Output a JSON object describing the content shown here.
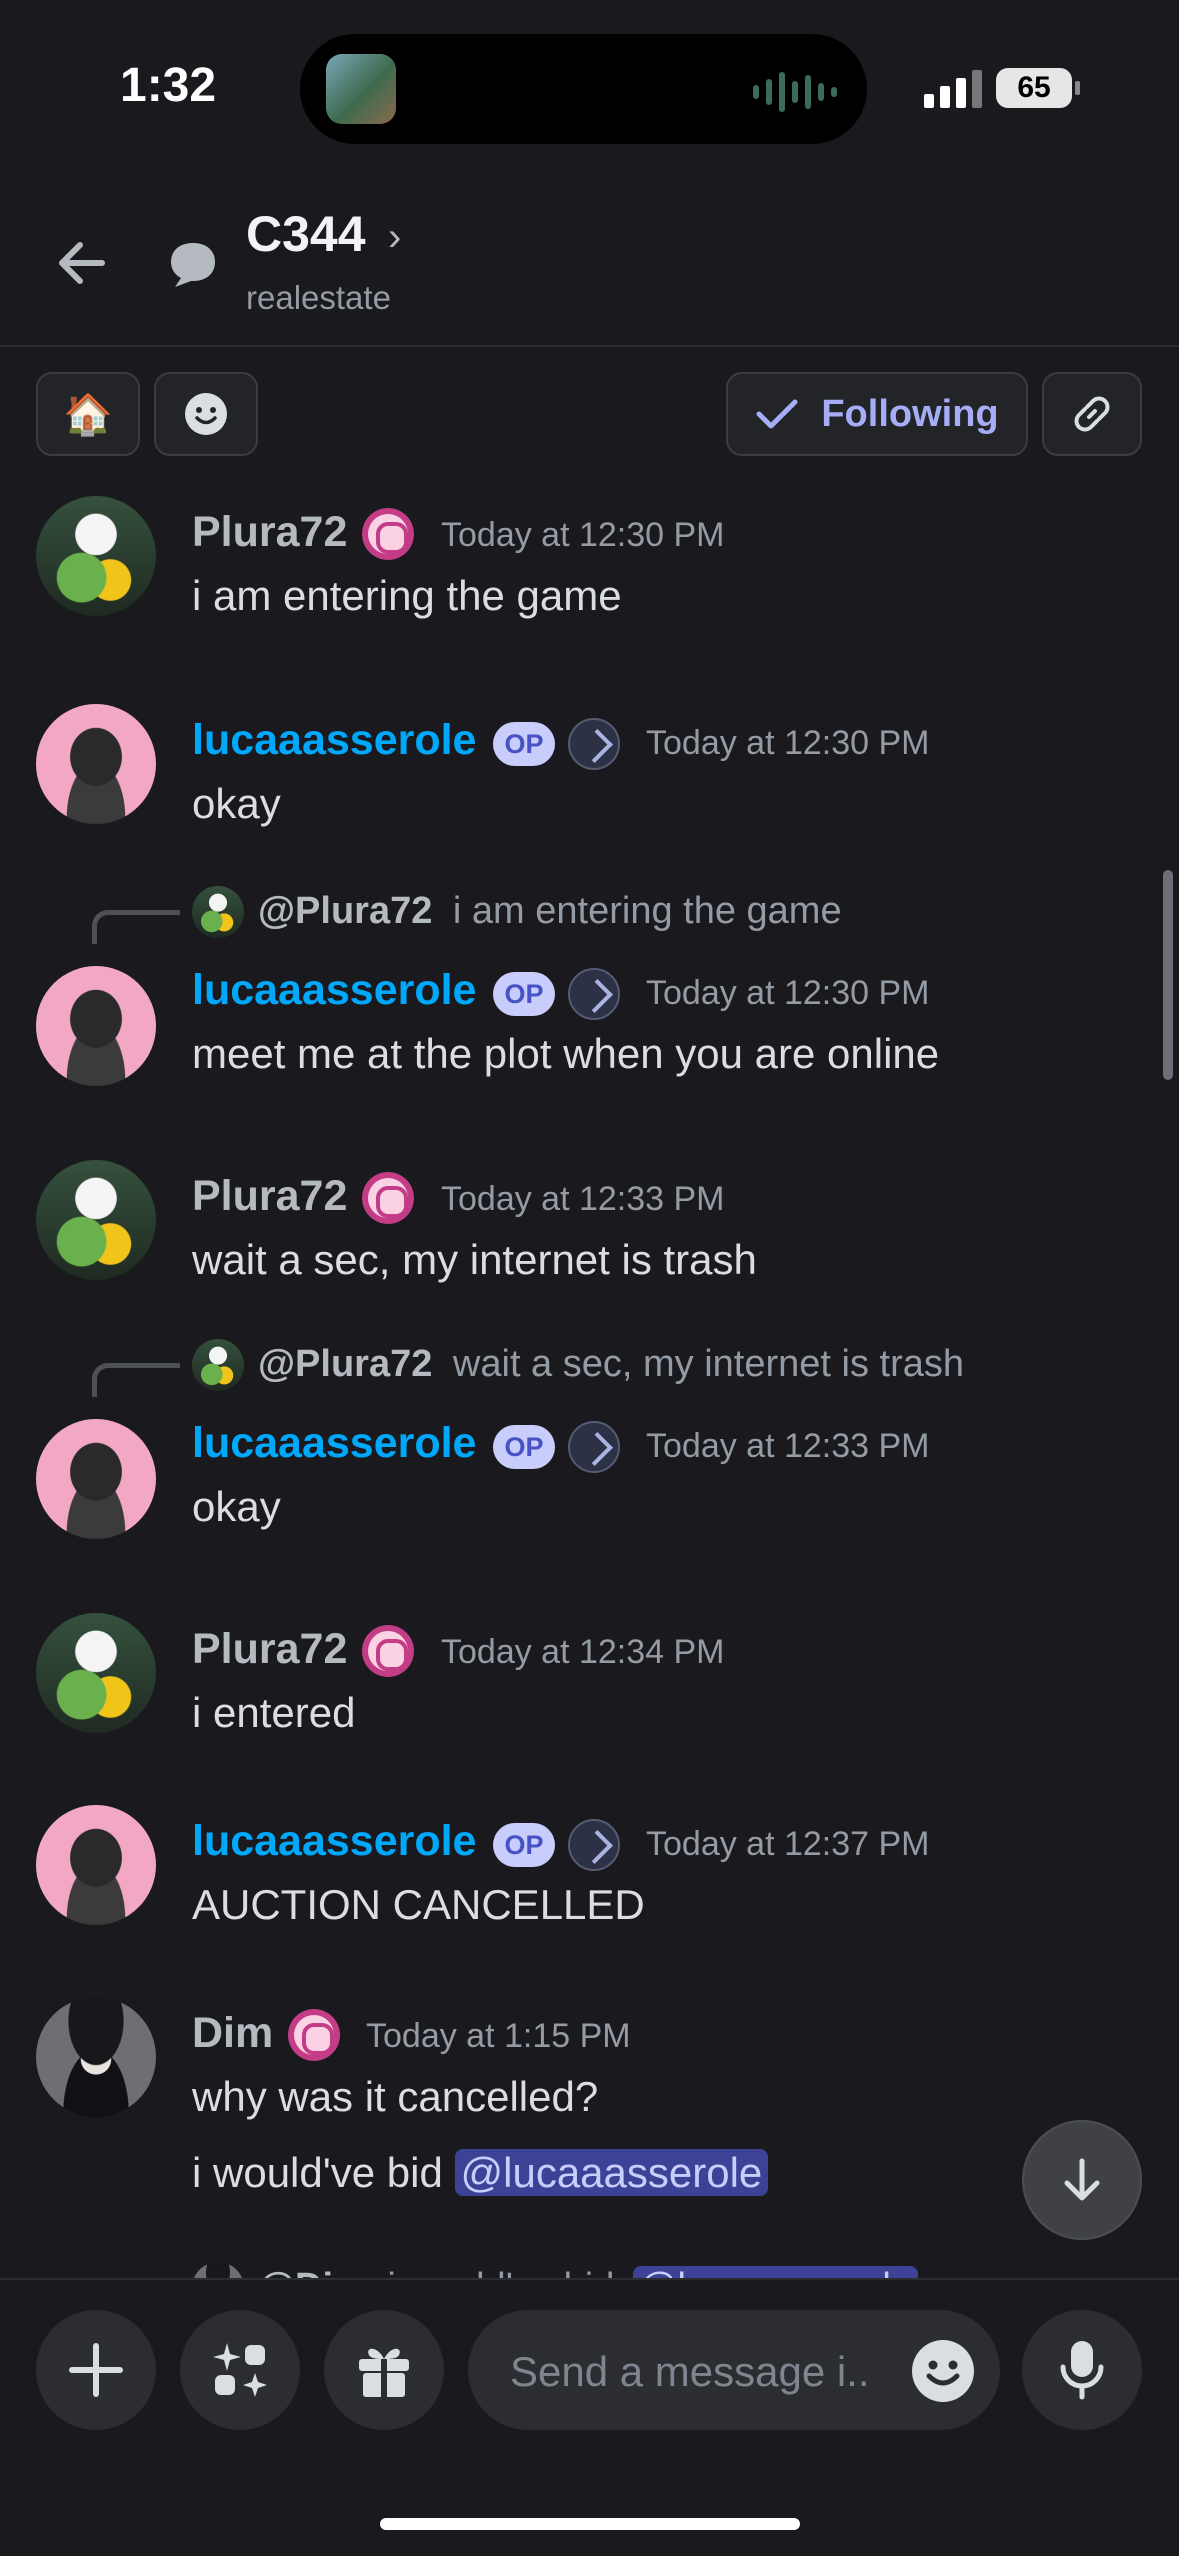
{
  "status_bar": {
    "time": "1:32",
    "battery": "65"
  },
  "header": {
    "channel_name": "C344",
    "subtitle": "realestate"
  },
  "toolbar": {
    "emoji_1": "🏠",
    "following_label": "Following"
  },
  "messages": [
    {
      "user": "Plura72",
      "time": "Today at 12:30 PM",
      "text": "i am entering the game"
    },
    {
      "user": "lucaaasserole",
      "op": "OP",
      "time": "Today at 12:30 PM",
      "text": "okay"
    },
    {
      "user": "lucaaasserole",
      "op": "OP",
      "time": "Today at 12:30 PM",
      "text": "meet me at the plot when you are online",
      "reply_user": "@Plura72",
      "reply_text": "i am entering the game"
    },
    {
      "user": "Plura72",
      "time": "Today at 12:33 PM",
      "text": "wait a sec, my internet is trash"
    },
    {
      "user": "lucaaasserole",
      "op": "OP",
      "time": "Today at 12:33 PM",
      "text": "okay",
      "reply_user": "@Plura72",
      "reply_text": "wait a sec, my internet is trash"
    },
    {
      "user": "Plura72",
      "time": "Today at 12:34 PM",
      "text": "i entered"
    },
    {
      "user": "lucaaasserole",
      "op": "OP",
      "time": "Today at 12:37 PM",
      "text": "AUCTION CANCELLED"
    },
    {
      "user": "Dim",
      "time": "Today at 1:15 PM",
      "text": "why was it cancelled?",
      "text2": "i would've bid ",
      "mention": "@lucaaasserole"
    }
  ],
  "partial_reply": {
    "user": "@Dim",
    "text": "i would've bid",
    "mention": "@lucaaasserole"
  },
  "composer": {
    "placeholder": "Send a message i.."
  }
}
